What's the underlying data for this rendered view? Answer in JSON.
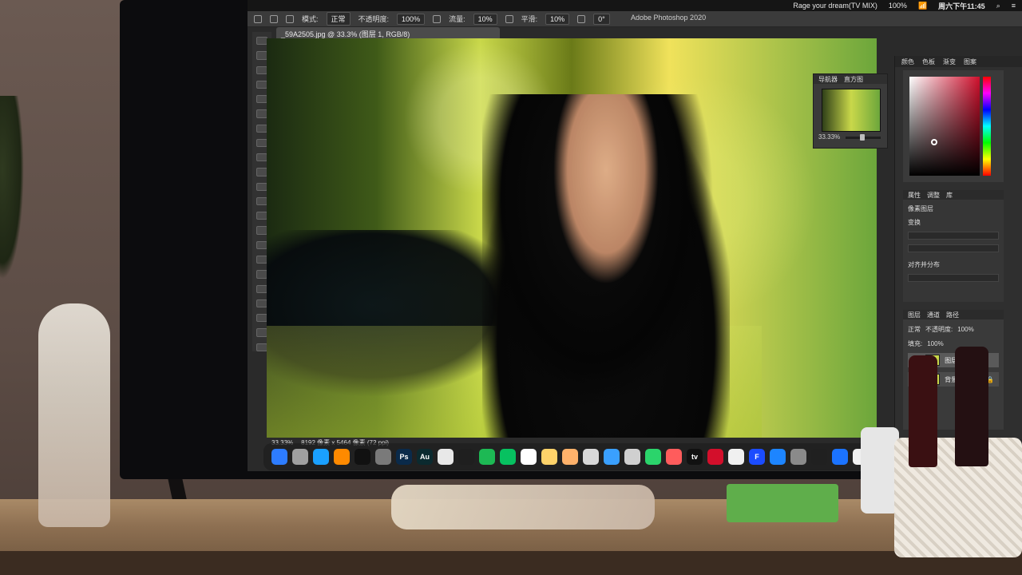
{
  "menubar": {
    "right_text": "Rage your dream(TV MIX)",
    "battery": "100%",
    "day_time": "周六下午11:45"
  },
  "photoshop": {
    "options": {
      "mode_label": "模式:",
      "mode_value": "正常",
      "opacity_label": "不透明度:",
      "opacity_value": "100%",
      "flow_label": "流量:",
      "flow_value": "10%",
      "smoothing_label": "平滑:",
      "smoothing_value": "10%",
      "angle_value": "0°"
    },
    "app_title": "Adobe Photoshop 2020",
    "doc_tab": "_59A2505.jpg @ 33.3% (图层 1, RGB/8)",
    "status": {
      "zoom": "33.33%",
      "doc_size": "8192 像素 x 5464 像素 (72 ppi)"
    },
    "navigator": {
      "tabs": [
        "导航器",
        "直方图"
      ],
      "zoom": "33.33%"
    },
    "right_dock": {
      "tabs": [
        "颜色",
        "色板",
        "渐变",
        "图案"
      ],
      "properties_tabs": [
        "属性",
        "调整",
        "库"
      ],
      "properties_section": "像素图层",
      "transform_label": "变换",
      "align_label": "对齐并分布",
      "layers_tabs": [
        "图层",
        "通道",
        "路径"
      ],
      "layers_blend": "正常",
      "layers_opacity_label": "不透明度:",
      "layers_opacity_value": "100%",
      "layers_fill_label": "填充:",
      "layers_fill_value": "100%",
      "layer_items": [
        {
          "name": "图层 1"
        },
        {
          "name": "背景"
        }
      ]
    }
  },
  "dock": {
    "apps": [
      {
        "name": "finder-icon",
        "glyph": "",
        "color": "#2d7cff"
      },
      {
        "name": "launchpad-icon",
        "glyph": "",
        "color": "#a0a0a0"
      },
      {
        "name": "safari-icon",
        "glyph": "",
        "color": "#1aa0ff"
      },
      {
        "name": "photos-icon",
        "glyph": "",
        "color": "#ff8a00"
      },
      {
        "name": "capcut-icon",
        "glyph": "",
        "color": "#111111"
      },
      {
        "name": "settings-icon",
        "glyph": "",
        "color": "#7a7a7a"
      },
      {
        "name": "ps-icon",
        "glyph": "Ps",
        "color": "#0a2a4a"
      },
      {
        "name": "au-icon",
        "glyph": "Au",
        "color": "#0b2a2f"
      },
      {
        "name": "chrome-icon",
        "glyph": "",
        "color": "#e8e8e8"
      },
      {
        "name": "vpn-icon",
        "glyph": "",
        "color": "#1f1f1f"
      },
      {
        "name": "spotify-icon",
        "glyph": "",
        "color": "#1db954"
      },
      {
        "name": "wechat-icon",
        "glyph": "",
        "color": "#07c160"
      },
      {
        "name": "calendar-icon",
        "glyph": "",
        "color": "#ffffff"
      },
      {
        "name": "notes-icon",
        "glyph": "",
        "color": "#ffd36a"
      },
      {
        "name": "files-icon",
        "glyph": "",
        "color": "#ffb26b"
      },
      {
        "name": "preview-icon",
        "glyph": "",
        "color": "#d8d8d8"
      },
      {
        "name": "chat-icon",
        "glyph": "",
        "color": "#3aa0ff"
      },
      {
        "name": "pen-icon",
        "glyph": "",
        "color": "#d0d0d0"
      },
      {
        "name": "messages-icon",
        "glyph": "",
        "color": "#2bd46b"
      },
      {
        "name": "colorful-icon",
        "glyph": "",
        "color": "#ff5c5c"
      },
      {
        "name": "apple-tv-icon",
        "glyph": "tv",
        "color": "#111111"
      },
      {
        "name": "netease-icon",
        "glyph": "",
        "color": "#d30f2b"
      },
      {
        "name": "music-icon",
        "glyph": "",
        "color": "#f0f0f0"
      },
      {
        "name": "final-cut-icon",
        "glyph": "F",
        "color": "#1b4cff"
      },
      {
        "name": "app-store-icon",
        "glyph": "",
        "color": "#1d85ff"
      },
      {
        "name": "system-prefs-icon",
        "glyph": "",
        "color": "#8a8a8a"
      },
      {
        "name": "terminal-icon",
        "glyph": "",
        "color": "#202020"
      },
      {
        "name": "xcode-icon",
        "glyph": "",
        "color": "#1b73ff"
      },
      {
        "name": "chrome2-icon",
        "glyph": "",
        "color": "#f0f0f0"
      },
      {
        "name": "red-icon",
        "glyph": "",
        "color": "#ff3b30"
      }
    ]
  }
}
